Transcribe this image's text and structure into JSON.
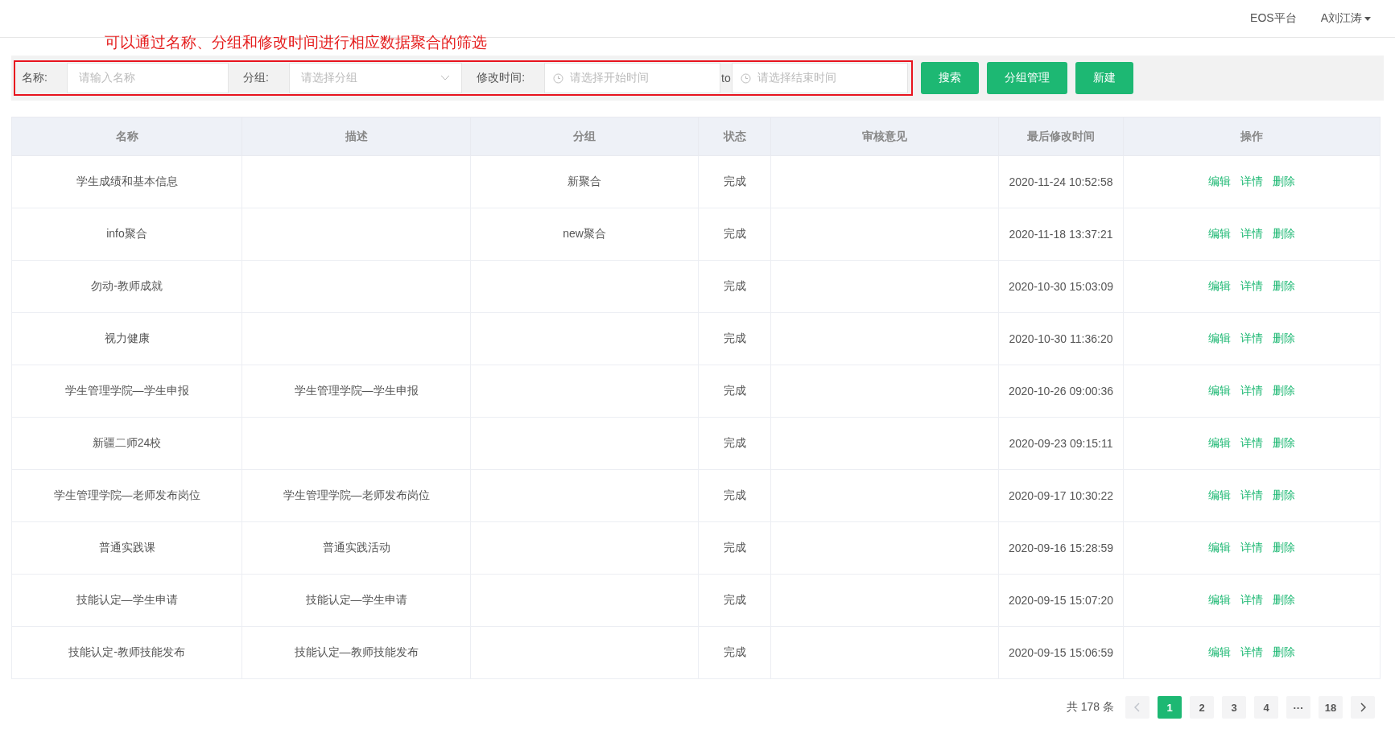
{
  "header": {
    "platform": "EOS平台",
    "user": "A刘江涛"
  },
  "annotation": {
    "text": "可以通过名称、分组和修改时间进行相应数据聚合的筛选"
  },
  "filters": {
    "name_label": "名称:",
    "name_placeholder": "请输入名称",
    "group_label": "分组:",
    "group_placeholder": "请选择分组",
    "time_label": "修改时间:",
    "start_placeholder": "请选择开始时间",
    "range_separator": "to",
    "end_placeholder": "请选择结束时间"
  },
  "buttons": [
    "搜索",
    "分组管理",
    "新建"
  ],
  "table": {
    "columns": [
      "名称",
      "描述",
      "分组",
      "状态",
      "审核意见",
      "最后修改时间",
      "操作"
    ],
    "rows": [
      {
        "name": "学生成绩和基本信息",
        "description": "",
        "group": "新聚合",
        "status": "完成",
        "review": "",
        "modified": "2020-11-24 10:52:58",
        "actions": [
          "编辑",
          "详情",
          "删除"
        ]
      },
      {
        "name": "info聚合",
        "description": "",
        "group": "new聚合",
        "status": "完成",
        "review": "",
        "modified": "2020-11-18 13:37:21",
        "actions": [
          "编辑",
          "详情",
          "删除"
        ]
      },
      {
        "name": "勿动-教师成就",
        "description": "",
        "group": "",
        "status": "完成",
        "review": "",
        "modified": "2020-10-30 15:03:09",
        "actions": [
          "编辑",
          "详情",
          "删除"
        ]
      },
      {
        "name": "视力健康",
        "description": "",
        "group": "",
        "status": "完成",
        "review": "",
        "modified": "2020-10-30 11:36:20",
        "actions": [
          "编辑",
          "详情",
          "删除"
        ]
      },
      {
        "name": "学生管理学院—学生申报",
        "description": "学生管理学院—学生申报",
        "group": "",
        "status": "完成",
        "review": "",
        "modified": "2020-10-26 09:00:36",
        "actions": [
          "编辑",
          "详情",
          "删除"
        ]
      },
      {
        "name": "新疆二师24校",
        "description": "",
        "group": "",
        "status": "完成",
        "review": "",
        "modified": "2020-09-23 09:15:11",
        "actions": [
          "编辑",
          "详情",
          "删除"
        ]
      },
      {
        "name": "学生管理学院—老师发布岗位",
        "description": "学生管理学院—老师发布岗位",
        "group": "",
        "status": "完成",
        "review": "",
        "modified": "2020-09-17 10:30:22",
        "actions": [
          "编辑",
          "详情",
          "删除"
        ]
      },
      {
        "name": "普通实践课",
        "description": "普通实践活动",
        "group": "",
        "status": "完成",
        "review": "",
        "modified": "2020-09-16 15:28:59",
        "actions": [
          "编辑",
          "详情",
          "删除"
        ]
      },
      {
        "name": "技能认定—学生申请",
        "description": "技能认定—学生申请",
        "group": "",
        "status": "完成",
        "review": "",
        "modified": "2020-09-15 15:07:20",
        "actions": [
          "编辑",
          "详情",
          "删除"
        ]
      },
      {
        "name": "技能认定-教师技能发布",
        "description": "技能认定—教师技能发布",
        "group": "",
        "status": "完成",
        "review": "",
        "modified": "2020-09-15 15:06:59",
        "actions": [
          "编辑",
          "详情",
          "删除"
        ]
      }
    ]
  },
  "pagination": {
    "total": "共 178 条",
    "prev_disabled": true,
    "next_disabled": false,
    "pages": [
      {
        "label": "1",
        "selected": true
      },
      {
        "label": "2",
        "selected": false
      },
      {
        "label": "3",
        "selected": false
      },
      {
        "label": "4",
        "selected": false
      },
      {
        "label": "···",
        "selected": false
      },
      {
        "label": "18",
        "selected": false
      }
    ]
  }
}
